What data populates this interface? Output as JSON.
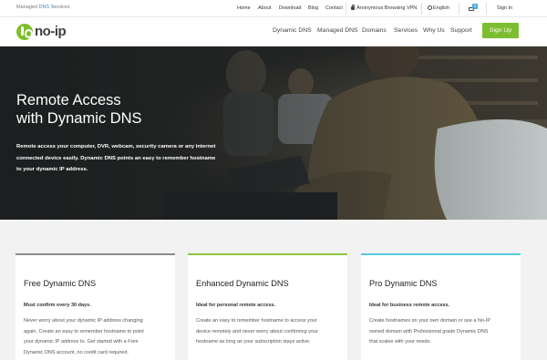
{
  "topbar": {
    "managed_prefix": "Managed",
    "managed_highlight": "DNS",
    "managed_suffix": "Services",
    "links": [
      "Home",
      "About",
      "Download",
      "Blog",
      "Contact"
    ],
    "vpn": "Anonymous Browsing VPN",
    "language": "English",
    "cart_count": "0",
    "signin": "Sign In"
  },
  "nav": {
    "logo_text": "no-ip",
    "links": [
      "Dynamic DNS",
      "Managed DNS",
      "Domains",
      "Services",
      "Why Us",
      "Support"
    ],
    "signup": "Sign Up"
  },
  "hero": {
    "title_line1": "Remote Access",
    "title_line2": "with Dynamic DNS",
    "body": "Remote access your computer, DVR, webcam, security camera or any internet connected device easily. Dynamic DNS points an easy to remember hostname to your dynamic IP address."
  },
  "cards": [
    {
      "title": "Free Dynamic DNS",
      "subtitle": "Must confirm every 30 days.",
      "lines": [
        "Never worry about your dynamic IP address changing",
        "again. Create an easy to remember hostname to point",
        "your dynamic IP address to. Get started with a Free",
        "Dynamic DNS account, no credit card required."
      ]
    },
    {
      "title": "Enhanced Dynamic DNS",
      "subtitle": "Ideal for personal remote access.",
      "lines": [
        "Create an easy to remember hostname to access your",
        "device remotely and never worry about confirming your",
        "hostname as long as your subscription stays active."
      ]
    },
    {
      "title": "Pro Dynamic DNS",
      "subtitle": "Ideal for business remote access.",
      "lines": [
        "Create hostnames on your own domain or use a No-IP",
        "owned domain with Professional grade Dynamic DNS",
        "that scales with your needs."
      ]
    }
  ]
}
